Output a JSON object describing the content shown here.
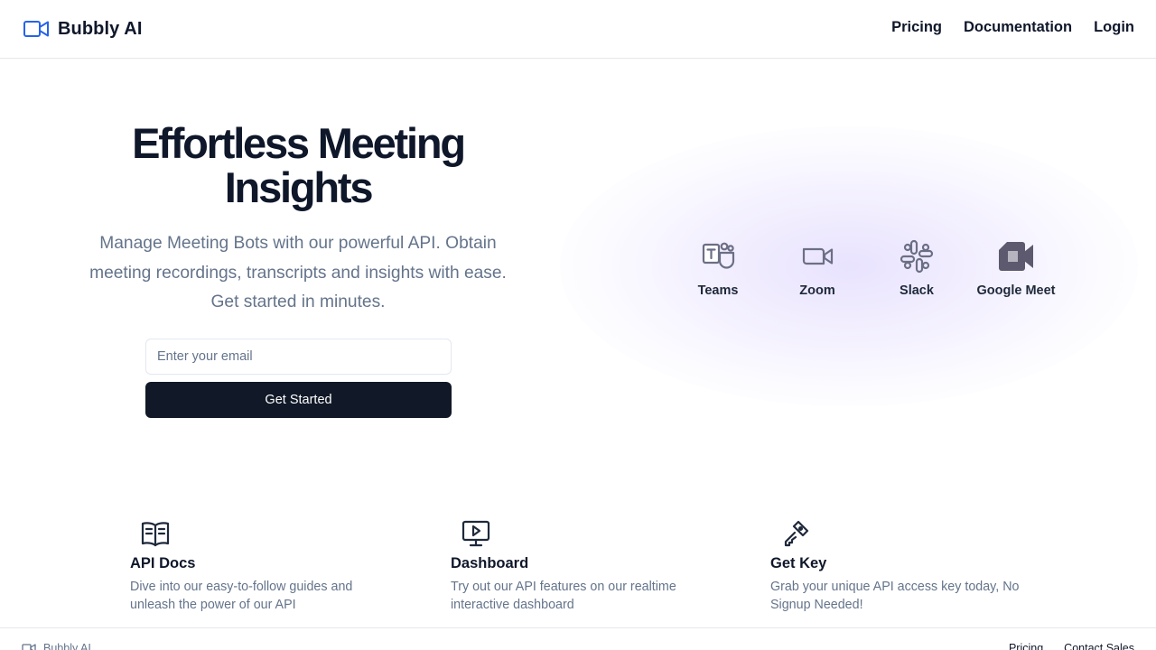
{
  "header": {
    "brand_name": "Bubbly AI",
    "brand_icon": "video-camera-icon",
    "nav": [
      "Pricing",
      "Documentation",
      "Login"
    ]
  },
  "hero": {
    "title_line1": "Effortless Meeting",
    "title_line2": "Insights",
    "subtitle": "Manage Meeting Bots with our powerful API. Obtain meeting recordings, transcripts and insights with ease. Get started in minutes.",
    "email_placeholder": "Enter your email",
    "cta_label": "Get Started"
  },
  "platforms": [
    {
      "label": "Teams",
      "icon": "microsoft-teams-icon"
    },
    {
      "label": "Zoom",
      "icon": "zoom-icon"
    },
    {
      "label": "Slack",
      "icon": "slack-icon"
    },
    {
      "label": "Google Meet",
      "icon": "google-meet-icon"
    }
  ],
  "features": [
    {
      "title": "API Docs",
      "description": "Dive into our easy-to-follow guides and unleash the power of our API",
      "icon": "open-book-icon"
    },
    {
      "title": "Dashboard",
      "description": "Try out our API features on our realtime interactive dashboard",
      "icon": "monitor-play-icon"
    },
    {
      "title": "Get Key",
      "description": "Grab your unique API access key today, No Signup Needed!",
      "icon": "key-icon"
    }
  ],
  "footer": {
    "brand_name": "Bubbly AI",
    "links": [
      "Pricing",
      "Contact Sales"
    ]
  },
  "colors": {
    "brand_icon": "#2563eb",
    "primary_button": "#111827",
    "muted_text": "#64748b",
    "glow": "#c4b5fd"
  }
}
